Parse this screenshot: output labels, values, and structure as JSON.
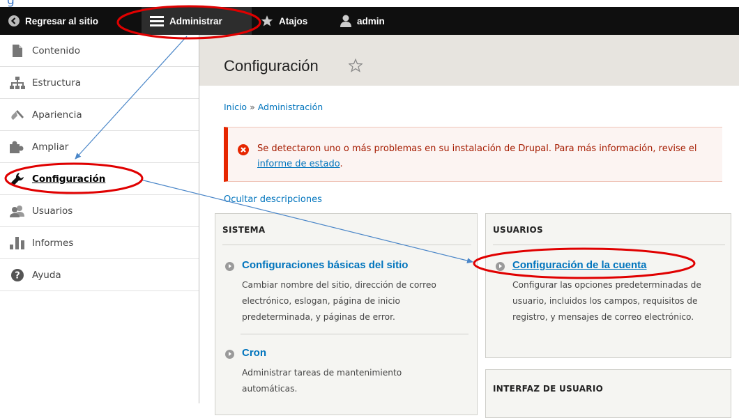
{
  "toolbar": {
    "back_label": "Regresar al sitio",
    "manage_label": "Administrar",
    "shortcuts_label": "Atajos",
    "user_label": "admin"
  },
  "sidebar": {
    "items": [
      {
        "label": "Contenido",
        "icon": "file-icon"
      },
      {
        "label": "Estructura",
        "icon": "hierarchy-icon"
      },
      {
        "label": "Apariencia",
        "icon": "brush-icon"
      },
      {
        "label": "Ampliar",
        "icon": "puzzle-icon"
      },
      {
        "label": "Configuración",
        "icon": "wrench-icon",
        "active": true
      },
      {
        "label": "Usuarios",
        "icon": "users-icon"
      },
      {
        "label": "Informes",
        "icon": "bar-chart-icon"
      },
      {
        "label": "Ayuda",
        "icon": "help-icon"
      }
    ]
  },
  "page": {
    "title": "Configuración",
    "breadcrumb": {
      "home": "Inicio",
      "separator": "»",
      "current": "Administración"
    }
  },
  "alert": {
    "text_before": "Se detectaron uno o más problemas en su instalación de Drupal. Para más información, revise el ",
    "link": "informe de estado",
    "text_after": "."
  },
  "hide_descriptions": "Ocultar descripciones",
  "panels": {
    "system": {
      "title": "SISTEMA",
      "entries": [
        {
          "link": "Configuraciones básicas del sitio",
          "desc": "Cambiar nombre del sitio, dirección de correo electrónico, eslogan, página de inicio predeterminada, y páginas de error."
        },
        {
          "link": "Cron",
          "desc": "Administrar tareas de mantenimiento automáticas."
        }
      ]
    },
    "users": {
      "title": "USUARIOS",
      "entries": [
        {
          "link": "Configuración de la cuenta",
          "desc": "Configurar las opciones predeterminadas de usuario, incluidos los campos, requisitos de registro, y mensajes de correo electrónico."
        }
      ]
    },
    "ui": {
      "title": "INTERFAZ DE USUARIO"
    }
  },
  "colors": {
    "toolbar_bg": "#0f0f0f",
    "link_blue": "#0074bd",
    "alert_red": "#e62600",
    "annotation_red": "#e00000",
    "annotation_arrow": "#4a86c8"
  }
}
